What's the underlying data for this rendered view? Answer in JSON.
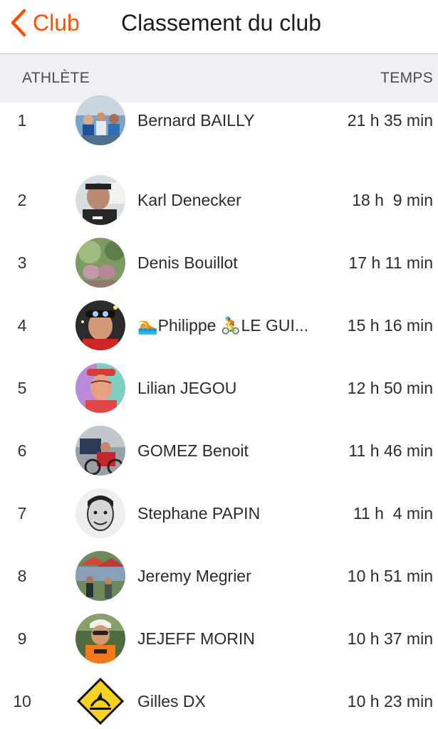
{
  "nav": {
    "back_label": "Club",
    "title": "Classement du club"
  },
  "columns": {
    "athlete": "ATHLÈTE",
    "time": "TEMPS"
  },
  "accent_color": "#fc5200",
  "rows": [
    {
      "rank": "1",
      "name": "Bernard BAILLY",
      "time": "21 h 35 min"
    },
    {
      "rank": "2",
      "name": "Karl Denecker",
      "time": "18 h  9 min"
    },
    {
      "rank": "3",
      "name": "Denis Bouillot",
      "time": "17 h 11 min"
    },
    {
      "rank": "4",
      "name": "🏊Philippe 🚴LE GUI...",
      "time": "15 h 16 min"
    },
    {
      "rank": "5",
      "name": "Lilian JEGOU",
      "time": "12 h 50 min"
    },
    {
      "rank": "6",
      "name": "GOMEZ Benoit",
      "time": "11 h 46 min"
    },
    {
      "rank": "7",
      "name": "Stephane PAPIN",
      "time": "11 h  4 min"
    },
    {
      "rank": "8",
      "name": "Jeremy Megrier",
      "time": "10 h 51 min"
    },
    {
      "rank": "9",
      "name": "JEJEFF MORIN",
      "time": "10 h 37 min"
    },
    {
      "rank": "10",
      "name": "Gilles DX",
      "time": "10 h 23 min"
    }
  ]
}
